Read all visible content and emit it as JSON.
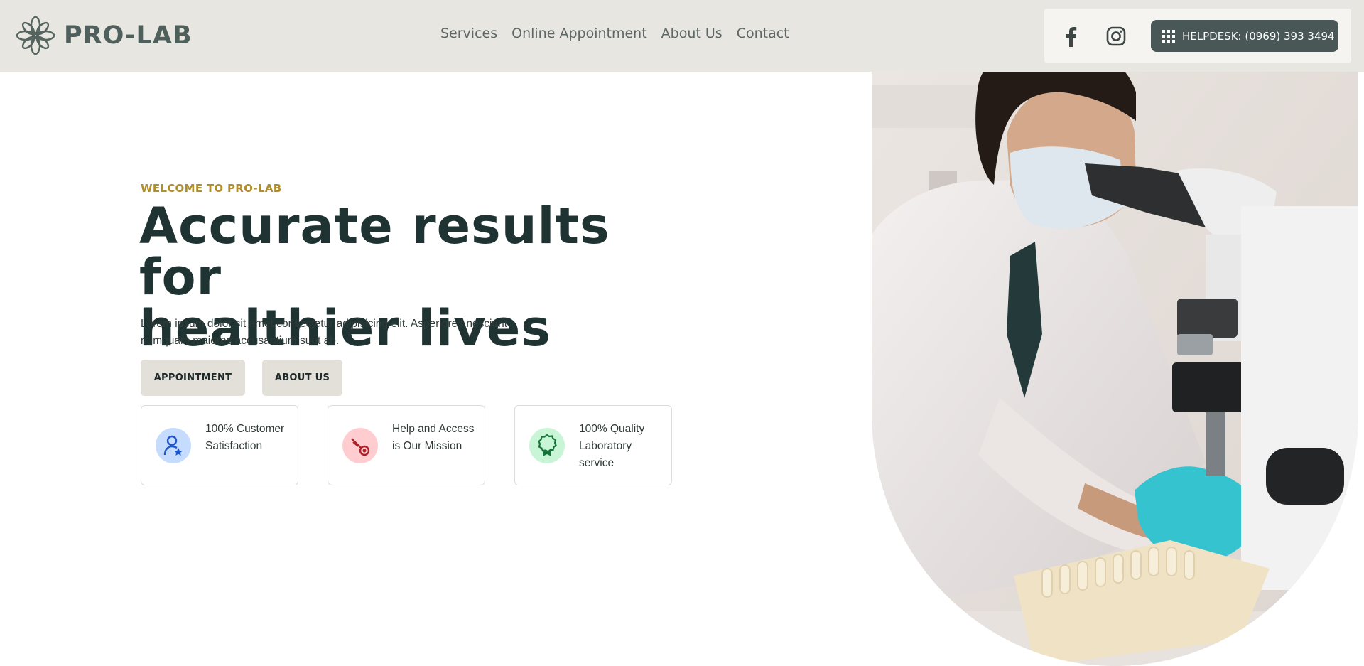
{
  "brand": {
    "name": "PRO-LAB",
    "logo_icon": "leaf-mandala-icon"
  },
  "nav": [
    {
      "label": "Services"
    },
    {
      "label": "Online Appointment"
    },
    {
      "label": "About Us"
    },
    {
      "label": "Contact"
    }
  ],
  "social": [
    {
      "icon": "facebook-icon"
    },
    {
      "icon": "instagram-icon"
    }
  ],
  "helpdesk": {
    "label": "HELPDESK: (0969) 393 3494",
    "icon": "grid-dots-icon"
  },
  "hero": {
    "eyebrow": "WELCOME TO PRO-LAB",
    "headline_line1": "Accurate results for",
    "headline_line2": "healthier lives",
    "lead": "Lorem ipsum dolor sit amet consectetur adipisicing elit. Asperiores nesciunt numquam maiores accusantium sunt ab.",
    "buttons": [
      {
        "label": "APPOINTMENT"
      },
      {
        "label": "ABOUT US"
      }
    ],
    "features": [
      {
        "text": "100% Customer Satisfaction",
        "icon": "user-star-icon",
        "bg": "#c6dcff",
        "fg": "#1f56c9"
      },
      {
        "text": "Help and Access is Our Mission",
        "icon": "needle-icon",
        "bg": "#ffcdd0",
        "fg": "#b01e26"
      },
      {
        "text": "100% Quality Laboratory service",
        "icon": "award-badge-icon",
        "bg": "#c9f5d7",
        "fg": "#18753a"
      }
    ],
    "photo_icon": "lab-scientist-microscope-photo"
  },
  "colors": {
    "header_bg": "#e8e6e1",
    "accent": "#b08e2a",
    "heading": "#1f3432",
    "button_bg": "#e3e0da",
    "helpdesk_bg": "#495856"
  }
}
